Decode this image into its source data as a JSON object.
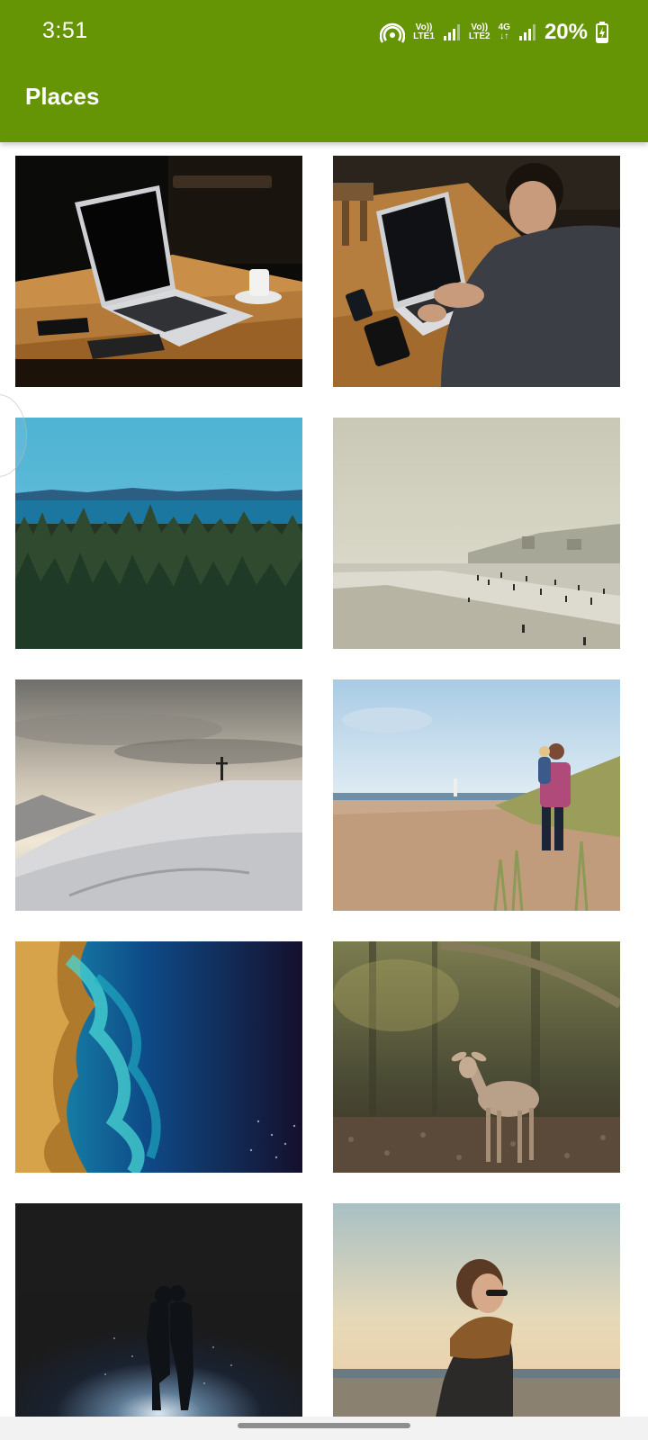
{
  "status_bar": {
    "time": "3:51",
    "sim1_label_top": "Vo))",
    "sim1_label_bottom": "LTE1",
    "sim2_label_top": "Vo))",
    "sim2_label_bottom": "LTE2",
    "network_type": "4G",
    "network_arrows": "↓↑",
    "battery_percent": "20%",
    "icons": [
      "hotspot-icon",
      "signal-icon",
      "signal-icon",
      "battery-charging-icon"
    ]
  },
  "app_bar": {
    "title": "Places",
    "color": "#659405"
  },
  "grid": {
    "columns": 2,
    "images": [
      {
        "name": "laptop-on-wooden-table"
      },
      {
        "name": "man-typing-on-laptop"
      },
      {
        "name": "forest-and-sea-view"
      },
      {
        "name": "misty-beach-with-people"
      },
      {
        "name": "snowy-hill-with-cross"
      },
      {
        "name": "father-and-child-on-beach"
      },
      {
        "name": "aerial-coastline-satellite"
      },
      {
        "name": "young-deer-in-forest"
      },
      {
        "name": "couple-silhouette-at-night"
      },
      {
        "name": "person-with-scarf-at-sunset"
      }
    ]
  }
}
